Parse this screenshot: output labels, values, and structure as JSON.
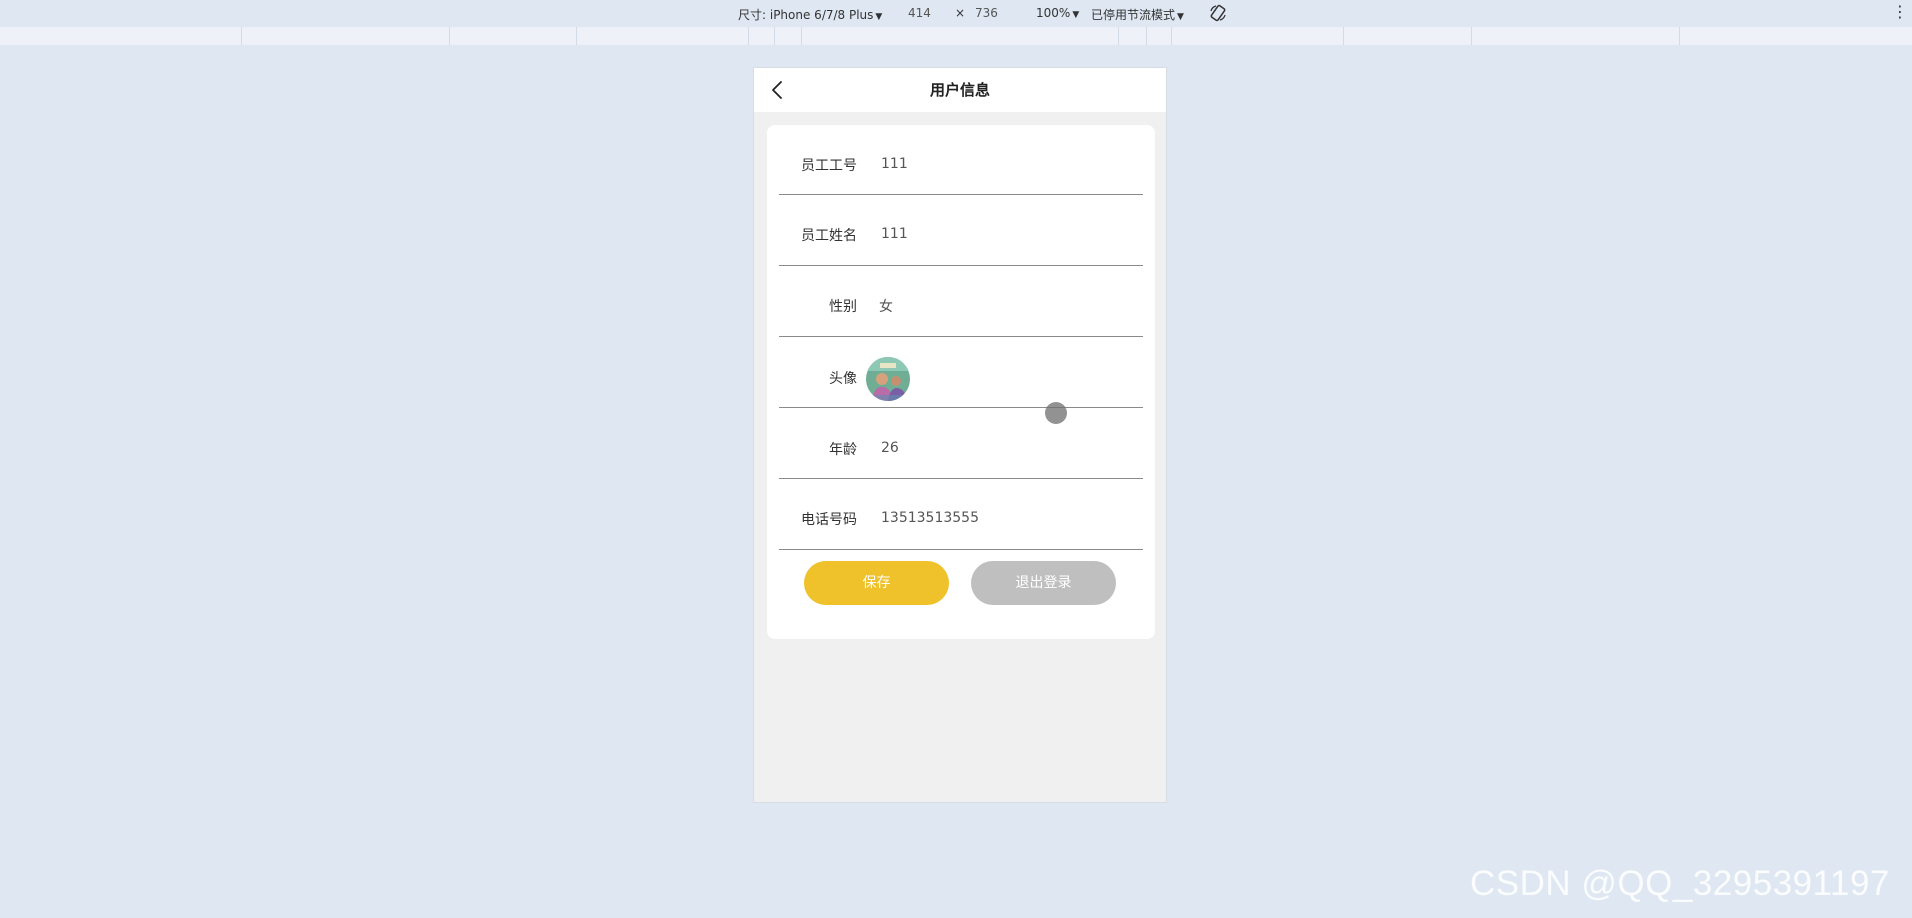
{
  "devtools": {
    "dimensions_label": "尺寸: iPhone 6/7/8 Plus",
    "width_value": "414",
    "times": "×",
    "height_value": "736",
    "zoom": "100%",
    "throttle": "已停用节流模式",
    "caret": "▼",
    "more_icon": "⋮",
    "rotate_icon": "rotate-icon"
  },
  "page": {
    "title": "用户信息",
    "back_icon": "chevron-left-icon"
  },
  "form": {
    "rows": [
      {
        "label": "员工工号",
        "value": "111"
      },
      {
        "label": "员工姓名",
        "value": "111"
      },
      {
        "label": "性别",
        "value": "女"
      },
      {
        "label": "头像",
        "value": ""
      },
      {
        "label": "年龄",
        "value": "26"
      },
      {
        "label": "电话号码",
        "value": "13513513555"
      }
    ]
  },
  "buttons": {
    "save": "保存",
    "logout": "退出登录"
  },
  "colors": {
    "save": "#efc12a",
    "logout": "#bfbfbf",
    "page_bg": "#dfe7f2"
  },
  "watermark": "CSDN @QQ_3295391197"
}
